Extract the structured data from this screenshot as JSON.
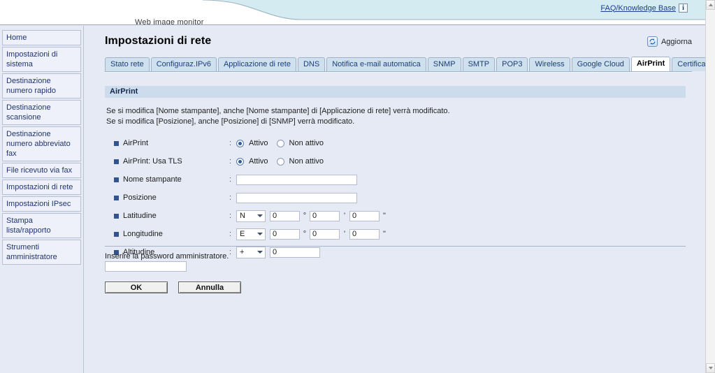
{
  "header": {
    "product_title": "Web image monitor",
    "faq_link": "FAQ/Knowledge Base",
    "info_icon_glyph": "i"
  },
  "sidebar": {
    "items": [
      {
        "label": "Home"
      },
      {
        "label": "Impostazioni di sistema"
      },
      {
        "label": "Destinazione numero rapido"
      },
      {
        "label": "Destinazione scansione"
      },
      {
        "label": "Destinazione numero abbreviato fax"
      },
      {
        "label": "File ricevuto via fax"
      },
      {
        "label": "Impostazioni di rete"
      },
      {
        "label": "Impostazioni IPsec"
      },
      {
        "label": "Stampa lista/rapporto"
      },
      {
        "label": "Strumenti amministratore"
      }
    ]
  },
  "main": {
    "page_title": "Impostazioni di rete",
    "refresh_label": "Aggiorna",
    "tabs": [
      {
        "label": "Stato rete",
        "active": false
      },
      {
        "label": "Configuraz.IPv6",
        "active": false
      },
      {
        "label": "Applicazione di rete",
        "active": false
      },
      {
        "label": "DNS",
        "active": false
      },
      {
        "label": "Notifica e-mail automatica",
        "active": false
      },
      {
        "label": "SNMP",
        "active": false
      },
      {
        "label": "SMTP",
        "active": false
      },
      {
        "label": "POP3",
        "active": false
      },
      {
        "label": "Wireless",
        "active": false
      },
      {
        "label": "Google Cloud",
        "active": false
      },
      {
        "label": "AirPrint",
        "active": true
      },
      {
        "label": "Certificate",
        "active": false
      }
    ],
    "section_title": "AirPrint",
    "note_line1": "Se si modifica [Nome stampante], anche [Nome stampante] di [Applicazione di rete] verrà modificato.",
    "note_line2": "Se si modifica [Posizione], anche [Posizione] di [SNMP] verrà modificato.",
    "fields": {
      "airprint": {
        "label": "AirPrint",
        "option_on": "Attivo",
        "option_off": "Non attivo",
        "selected": "Attivo"
      },
      "airprint_tls": {
        "label": "AirPrint: Usa TLS",
        "option_on": "Attivo",
        "option_off": "Non attivo",
        "selected": "Attivo"
      },
      "printer_name": {
        "label": "Nome stampante",
        "value": ""
      },
      "location": {
        "label": "Posizione",
        "value": ""
      },
      "latitude": {
        "label": "Latitudine",
        "hemisphere": "N",
        "degrees": "0",
        "minutes": "0",
        "seconds": "0",
        "unit_deg": "°",
        "unit_min": "'",
        "unit_sec": "\""
      },
      "longitude": {
        "label": "Longitudine",
        "hemisphere": "E",
        "degrees": "0",
        "minutes": "0",
        "seconds": "0",
        "unit_deg": "°",
        "unit_min": "'",
        "unit_sec": "\""
      },
      "altitude": {
        "label": "Altitudine",
        "sign": "+",
        "value": "0"
      }
    },
    "password": {
      "label": "Inserire la password amministratore.",
      "value": ""
    },
    "buttons": {
      "ok": "OK",
      "cancel": "Annulla"
    }
  },
  "colors": {
    "page_bg": "#e6eaf5",
    "banner_accent": "#cfe9ee",
    "tab_inactive": "#cfe0ef",
    "section_head": "#ccdcec",
    "bullet": "#33538f",
    "link": "#1d3f8f"
  }
}
